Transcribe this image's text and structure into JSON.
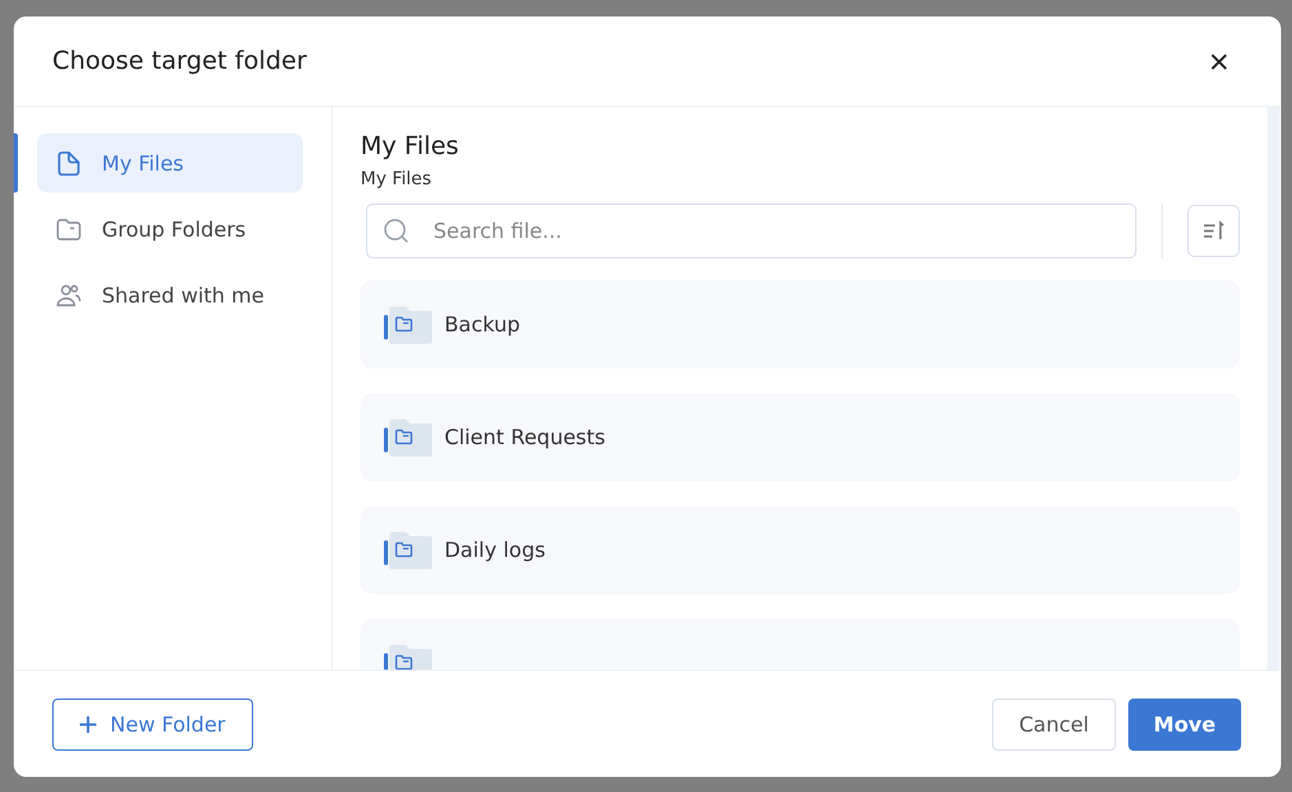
{
  "dialog": {
    "title": "Choose target folder"
  },
  "sidebar": {
    "items": [
      {
        "label": "My Files",
        "kind": "file",
        "selected": true
      },
      {
        "label": "Group Folders",
        "kind": "folder",
        "selected": false
      },
      {
        "label": "Shared with me",
        "kind": "people",
        "selected": false
      }
    ]
  },
  "main": {
    "title": "My Files",
    "breadcrumb": "My Files",
    "search": {
      "placeholder": "Search file..."
    },
    "folders": [
      {
        "name": "Backup"
      },
      {
        "name": "Client Requests"
      },
      {
        "name": "Daily logs"
      }
    ],
    "more_below": true
  },
  "footer": {
    "new_folder": "New Folder",
    "cancel": "Cancel",
    "move": "Move"
  }
}
